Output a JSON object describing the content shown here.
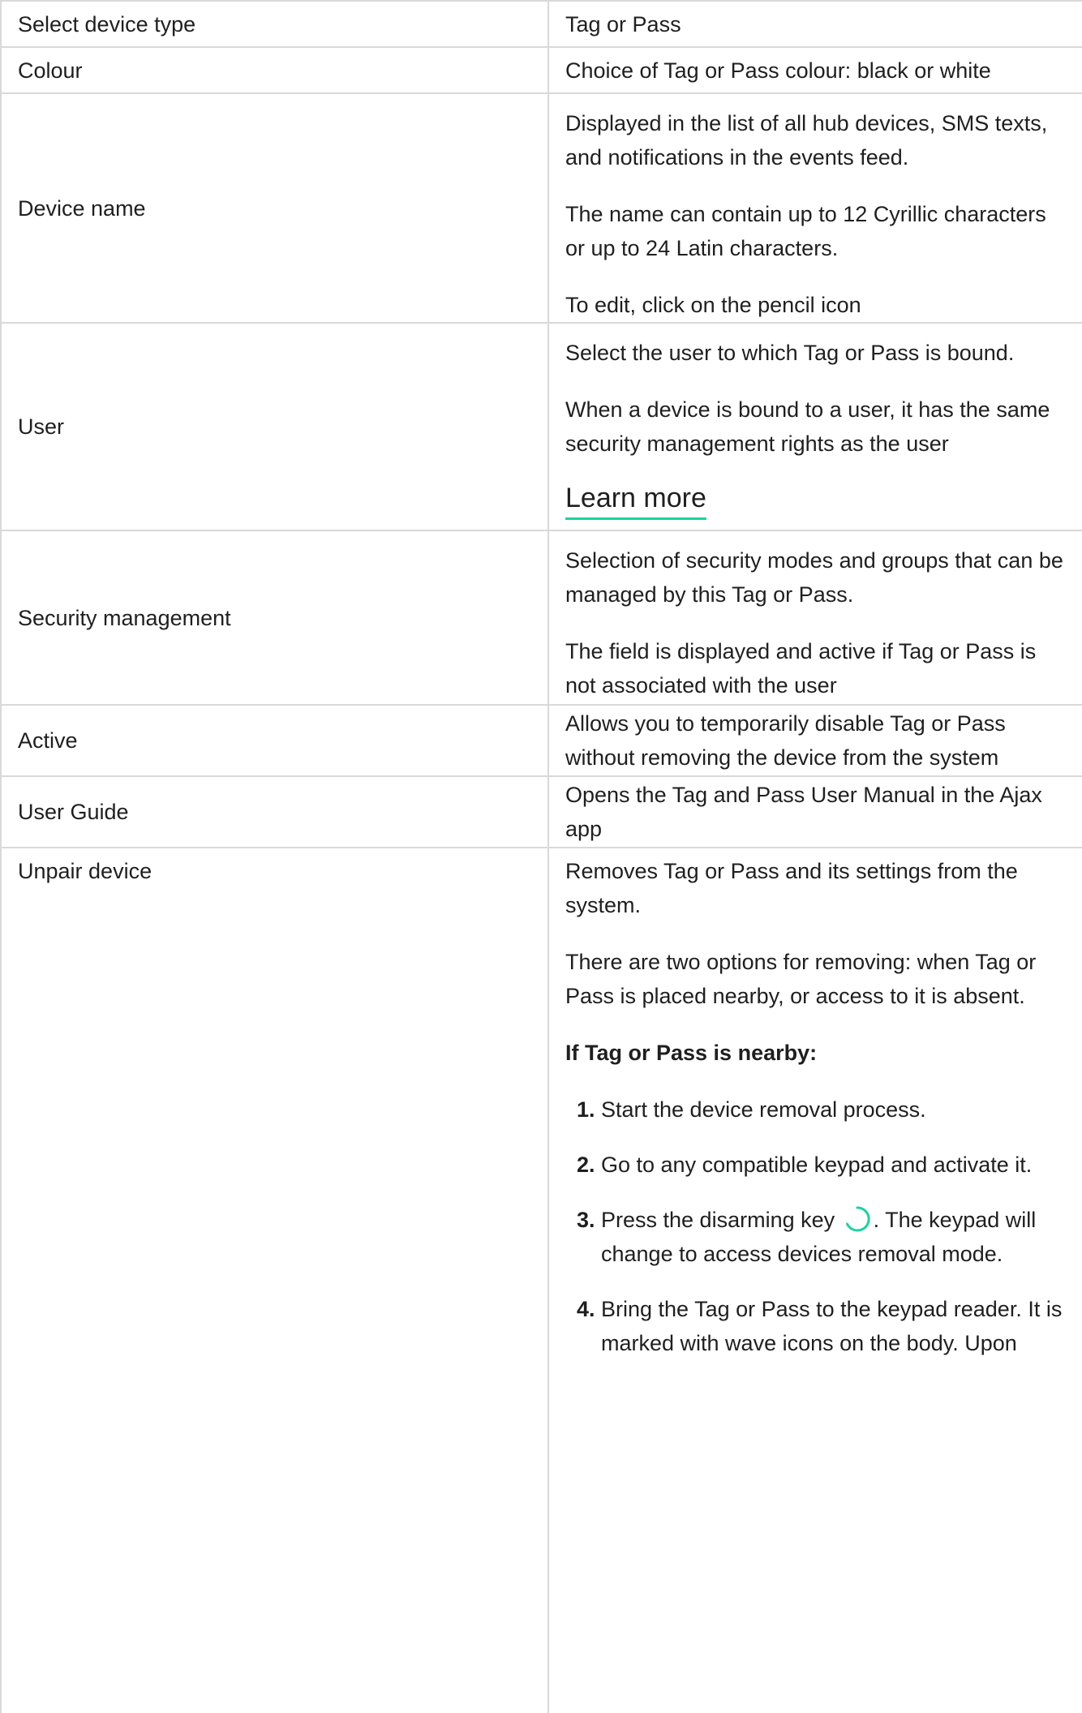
{
  "rows": [
    {
      "name": "Select device type",
      "value": [
        "Tag or Pass"
      ]
    },
    {
      "name": "Colour",
      "value": [
        "Choice of Tag or Pass colour: black or white"
      ]
    },
    {
      "name": "Device name",
      "value": [
        "Displayed in the list of all hub devices, SMS texts, and notifications in the events feed.",
        "The name can contain up to 12 Cyrillic characters or up to 24 Latin characters.",
        "To edit, click on the pencil icon"
      ]
    },
    {
      "name": "User",
      "value": [
        "Select the user to which Tag or Pass is bound.",
        "When a device is bound to a user, it has the same security management rights as the user"
      ],
      "link": "Learn more"
    },
    {
      "name": "Security management",
      "value": [
        "Selection of security modes and groups that can be managed by this Tag or Pass.",
        "The field is displayed and active if Tag or Pass is not associated with the user"
      ]
    },
    {
      "name": "Active",
      "value": [
        "Allows you to temporarily disable Tag or Pass without removing the device from the system"
      ]
    },
    {
      "name": "User Guide",
      "value": [
        "Opens the Tag and Pass User Manual in the Ajax app"
      ]
    },
    {
      "name": "Unpair device",
      "value": [
        "Removes Tag or Pass and its settings from the system.",
        "There are two options for removing: when Tag or Pass is placed nearby, or access to it is absent."
      ],
      "subheading": "If Tag or Pass is nearby:",
      "steps": [
        {
          "num": "1.",
          "text": "Start the device removal process."
        },
        {
          "num": "2.",
          "text": "Go to any compatible keypad and activate it."
        },
        {
          "num": "3.",
          "text_before": "Press the disarming key",
          "text_after": ". The keypad will change to access devices removal mode."
        },
        {
          "num": "4.",
          "text": "Bring the Tag or Pass to the keypad reader. It is marked with wave icons on the body. Upon"
        }
      ]
    }
  ],
  "colors": {
    "link_underline": "#19d3a0",
    "border": "#d9d9d9",
    "text": "#1f1f1f"
  },
  "icons": {
    "disarm_key": "disarm-circle-icon"
  }
}
